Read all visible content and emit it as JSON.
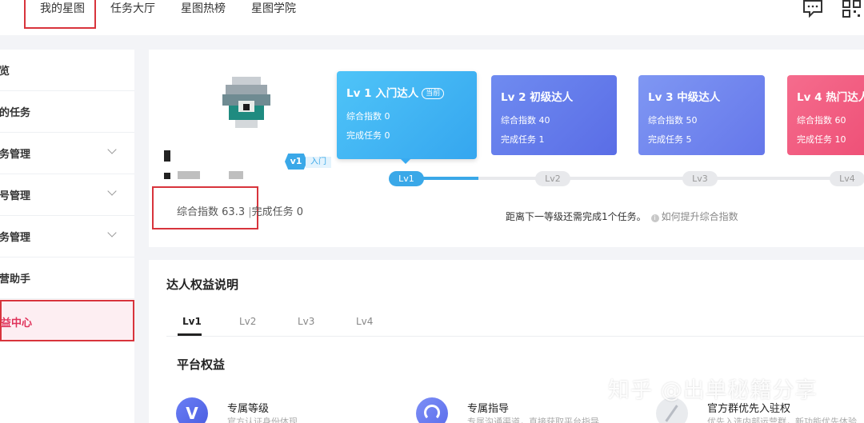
{
  "nav": {
    "items": [
      "我的星图",
      "任务大厅",
      "星图热榜",
      "星图学院"
    ],
    "message_icon": "message-icon",
    "qrcode_icon": "qrcode-icon"
  },
  "sidebar": {
    "items": [
      {
        "label": "览",
        "has_chevron": false
      },
      {
        "label": "的任务",
        "has_chevron": false
      },
      {
        "label": "务管理",
        "has_chevron": true
      },
      {
        "label": "号管理",
        "has_chevron": true
      },
      {
        "label": "务管理",
        "has_chevron": true
      },
      {
        "label": "营助手",
        "has_chevron": false
      },
      {
        "label": "益中心",
        "has_chevron": false,
        "active": true
      }
    ]
  },
  "profile": {
    "level_tag_icon": "v1",
    "level_tag_text": "入门",
    "stats_index_label": "综合指数",
    "stats_index_value": "63.3",
    "stats_separator": "|",
    "stats_tasks_label": "完成任务",
    "stats_tasks_value": "0"
  },
  "levels": [
    {
      "title": "Lv 1 入门达人",
      "badge": "当前",
      "index_line": "综合指数 0",
      "tasks_line": "完成任务 0"
    },
    {
      "title": "Lv 2 初级达人",
      "badge": "",
      "index_line": "综合指数 40",
      "tasks_line": "完成任务 1"
    },
    {
      "title": "Lv 3 中级达人",
      "badge": "",
      "index_line": "综合指数 50",
      "tasks_line": "完成任务 5"
    },
    {
      "title": "Lv 4 热门达人",
      "badge": "",
      "index_line": "综合指数 60",
      "tasks_line": "完成任务 10"
    }
  ],
  "progress": {
    "steps": [
      "Lv1",
      "Lv2",
      "Lv3",
      "Lv4"
    ],
    "current_step": "Lv1",
    "hint": "距离下一等级还需完成1个任务。",
    "info_icon": "i",
    "help_link": "如何提升综合指数"
  },
  "rights": {
    "title": "达人权益说明",
    "tabs": [
      "Lv1",
      "Lv2",
      "Lv3",
      "Lv4"
    ],
    "active_tab": "Lv1",
    "section_title": "平台权益",
    "benefits": [
      {
        "name": "专属等级",
        "desc": "官方认证身份体现",
        "icon": "v-badge-icon",
        "icon_glyph": "V"
      },
      {
        "name": "专属指导",
        "desc": "专属沟通渠道，直接获取平台指导",
        "icon": "headset-icon"
      },
      {
        "name": "官方群优先入驻权",
        "desc": "优先入选内部运营群，新功能优先体验",
        "icon": "disabled-icon"
      }
    ]
  },
  "watermark": "知乎 @出单秘籍分享",
  "colors": {
    "accent_red": "#d8343c",
    "blue": "#3aa8e8",
    "lv1": "#3aa8e8",
    "lv2": "#5a6de6",
    "lv3": "#6577ea",
    "lv4": "#ee4f76"
  }
}
